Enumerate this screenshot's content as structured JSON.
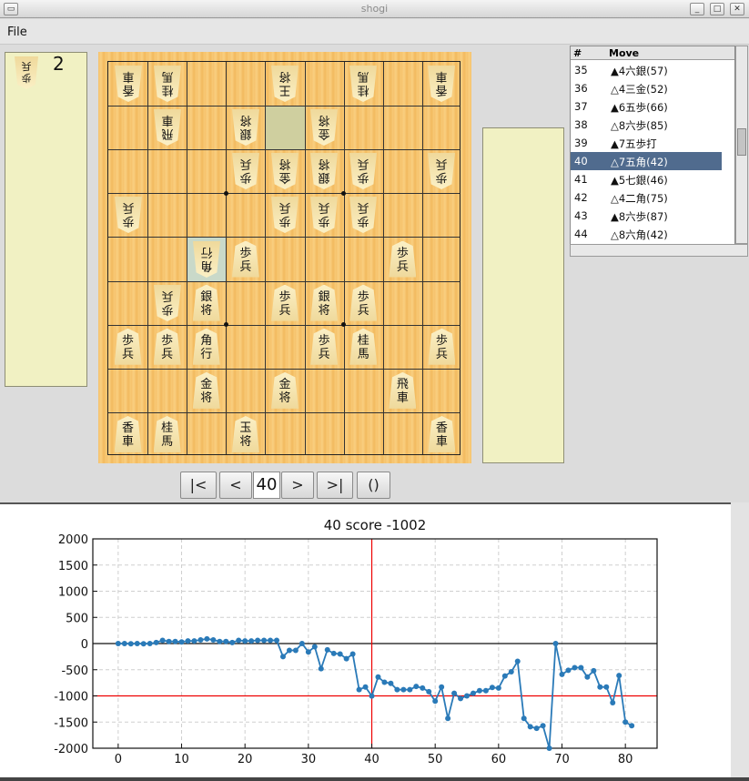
{
  "window": {
    "title": "shogi"
  },
  "menu": {
    "file": "File"
  },
  "sente_hand": [
    {
      "piece": "歩\n兵",
      "count": "2"
    }
  ],
  "board": {
    "pieces": [
      {
        "c": 9,
        "r": 1,
        "t": "香\n車",
        "g": true
      },
      {
        "c": 8,
        "r": 1,
        "t": "桂\n馬",
        "g": true
      },
      {
        "c": 5,
        "r": 1,
        "t": "王\n将",
        "g": true
      },
      {
        "c": 3,
        "r": 1,
        "t": "桂\n馬",
        "g": true
      },
      {
        "c": 1,
        "r": 1,
        "t": "香\n車",
        "g": true
      },
      {
        "c": 8,
        "r": 2,
        "t": "飛\n車",
        "g": true
      },
      {
        "c": 6,
        "r": 2,
        "t": "銀\n将",
        "g": true
      },
      {
        "c": 4,
        "r": 2,
        "t": "金\n将",
        "g": true
      },
      {
        "c": 6,
        "r": 3,
        "t": "歩\n兵",
        "g": true
      },
      {
        "c": 5,
        "r": 3,
        "t": "金\n将",
        "g": true
      },
      {
        "c": 4,
        "r": 3,
        "t": "銀\n将",
        "g": true
      },
      {
        "c": 3,
        "r": 3,
        "t": "歩\n兵",
        "g": true
      },
      {
        "c": 1,
        "r": 3,
        "t": "歩\n兵",
        "g": true
      },
      {
        "c": 9,
        "r": 4,
        "t": "歩\n兵",
        "g": true
      },
      {
        "c": 5,
        "r": 4,
        "t": "歩\n兵",
        "g": true
      },
      {
        "c": 4,
        "r": 4,
        "t": "歩\n兵",
        "g": true
      },
      {
        "c": 3,
        "r": 4,
        "t": "歩\n兵",
        "g": true
      },
      {
        "c": 7,
        "r": 5,
        "t": "角\n行",
        "g": true
      },
      {
        "c": 6,
        "r": 5,
        "t": "歩\n兵",
        "g": false
      },
      {
        "c": 2,
        "r": 5,
        "t": "歩\n兵",
        "g": false
      },
      {
        "c": 8,
        "r": 6,
        "t": "歩\n兵",
        "g": true
      },
      {
        "c": 7,
        "r": 6,
        "t": "銀\n将",
        "g": false
      },
      {
        "c": 5,
        "r": 6,
        "t": "歩\n兵",
        "g": false
      },
      {
        "c": 4,
        "r": 6,
        "t": "銀\n将",
        "g": false
      },
      {
        "c": 3,
        "r": 6,
        "t": "歩\n兵",
        "g": false
      },
      {
        "c": 9,
        "r": 7,
        "t": "歩\n兵",
        "g": false
      },
      {
        "c": 8,
        "r": 7,
        "t": "歩\n兵",
        "g": false
      },
      {
        "c": 7,
        "r": 7,
        "t": "角\n行",
        "g": false
      },
      {
        "c": 4,
        "r": 7,
        "t": "歩\n兵",
        "g": false
      },
      {
        "c": 3,
        "r": 7,
        "t": "桂\n馬",
        "g": false
      },
      {
        "c": 1,
        "r": 7,
        "t": "歩\n兵",
        "g": false
      },
      {
        "c": 7,
        "r": 8,
        "t": "金\n将",
        "g": false
      },
      {
        "c": 5,
        "r": 8,
        "t": "金\n将",
        "g": false
      },
      {
        "c": 2,
        "r": 8,
        "t": "飛\n車",
        "g": false
      },
      {
        "c": 9,
        "r": 9,
        "t": "香\n車",
        "g": false
      },
      {
        "c": 8,
        "r": 9,
        "t": "桂\n馬",
        "g": false
      },
      {
        "c": 6,
        "r": 9,
        "t": "玉\n将",
        "g": false
      },
      {
        "c": 1,
        "r": 9,
        "t": "香\n車",
        "g": false
      }
    ]
  },
  "moves_list": {
    "headers": [
      "#",
      "Move"
    ],
    "rows": [
      {
        "n": "35",
        "m": "▲4六銀(57)"
      },
      {
        "n": "36",
        "m": "△4三金(52)"
      },
      {
        "n": "37",
        "m": "▲6五歩(66)"
      },
      {
        "n": "38",
        "m": "△8六歩(85)"
      },
      {
        "n": "39",
        "m": "▲7五歩打"
      },
      {
        "n": "40",
        "m": "△7五角(42)",
        "sel": true
      },
      {
        "n": "41",
        "m": "▲5七銀(46)"
      },
      {
        "n": "42",
        "m": "△4二角(75)"
      },
      {
        "n": "43",
        "m": "▲8六歩(87)"
      },
      {
        "n": "44",
        "m": "△8六角(42)"
      }
    ]
  },
  "nav": {
    "first": "|<",
    "prev": "<",
    "current": "40",
    "next": ">",
    "last": ">|",
    "paren": "()"
  },
  "chart_data": {
    "type": "line",
    "title": "40 score -1002",
    "xlim": [
      -4,
      85
    ],
    "ylim": [
      -2000,
      2000
    ],
    "xticks": [
      "0",
      "10",
      "20",
      "30",
      "40",
      "50",
      "60",
      "70",
      "80"
    ],
    "yticks": [
      "2000",
      "1500",
      "1000",
      "500",
      "0",
      "-500",
      "-1000",
      "-1500",
      "-2000"
    ],
    "grid": true,
    "marker_x": 40,
    "marker_y": -1000,
    "series_color": "#2a7ab8",
    "x": [
      0,
      1,
      2,
      3,
      4,
      5,
      6,
      7,
      8,
      9,
      10,
      11,
      12,
      13,
      14,
      15,
      16,
      17,
      18,
      19,
      20,
      21,
      22,
      23,
      24,
      25,
      26,
      27,
      28,
      29,
      30,
      31,
      32,
      33,
      34,
      35,
      36,
      37,
      38,
      39,
      40,
      41,
      42,
      43,
      44,
      45,
      46,
      47,
      48,
      49,
      50,
      51,
      52,
      53,
      54,
      55,
      56,
      57,
      58,
      59,
      60,
      61,
      62,
      63,
      64,
      65,
      66,
      67,
      68,
      69,
      70,
      71,
      72,
      73,
      74,
      75,
      76,
      77,
      78,
      79,
      80,
      81
    ],
    "y": [
      0,
      0,
      -5,
      0,
      -5,
      0,
      20,
      60,
      40,
      40,
      30,
      50,
      50,
      70,
      90,
      70,
      40,
      40,
      20,
      60,
      50,
      50,
      60,
      60,
      60,
      60,
      -250,
      -130,
      -130,
      0,
      -160,
      -60,
      -480,
      -120,
      -190,
      -200,
      -290,
      -200,
      -880,
      -830,
      -1002,
      -640,
      -740,
      -760,
      -880,
      -880,
      -880,
      -820,
      -850,
      -920,
      -1100,
      -830,
      -1430,
      -950,
      -1050,
      -1000,
      -950,
      -900,
      -900,
      -840,
      -850,
      -620,
      -540,
      -340,
      -1430,
      -1590,
      -1620,
      -1570,
      -2000,
      0,
      -590,
      -510,
      -460,
      -460,
      -640,
      -520,
      -830,
      -830,
      -1130,
      -610,
      -1500,
      -1570
    ]
  }
}
